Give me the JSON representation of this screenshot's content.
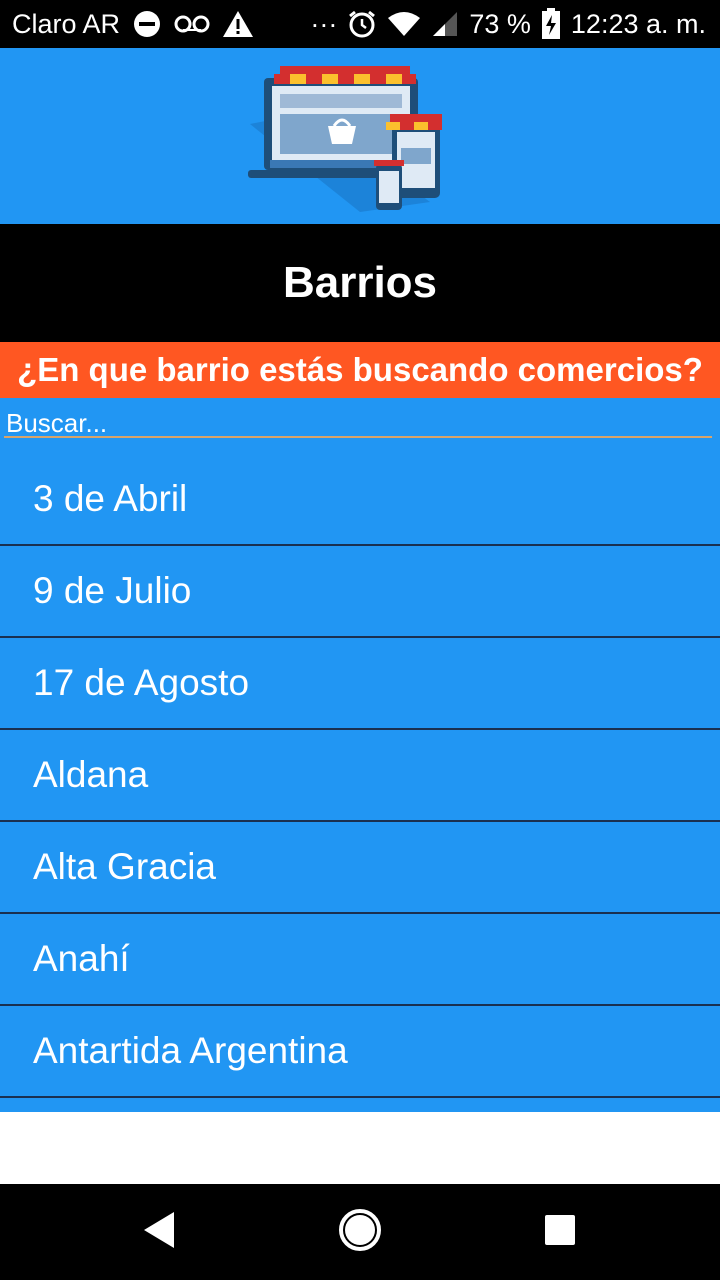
{
  "status_bar": {
    "carrier": "Claro AR",
    "dots": "···",
    "battery": "73 %",
    "time": "12:23 a. m.",
    "icons": [
      "dnd-icon",
      "voicemail-icon",
      "warning-icon",
      "alarm-icon",
      "wifi-icon",
      "signal-icon",
      "battery-icon"
    ]
  },
  "header": {
    "logo": "shop-devices-logo"
  },
  "title": "Barrios",
  "question": "¿En que barrio estás buscando comercios?",
  "search": {
    "placeholder": "Buscar..."
  },
  "neighborhoods": [
    "3 de Abril",
    "9 de Julio",
    "17 de Agosto",
    "Aldana",
    "Alta Gracia",
    "Anahí",
    "Antartida Argentina"
  ],
  "colors": {
    "primary": "#2196f3",
    "accent": "#ff5722",
    "title_bg": "#000000"
  },
  "nav_bar": {
    "icons": [
      "back-icon",
      "home-icon",
      "recents-icon"
    ]
  }
}
